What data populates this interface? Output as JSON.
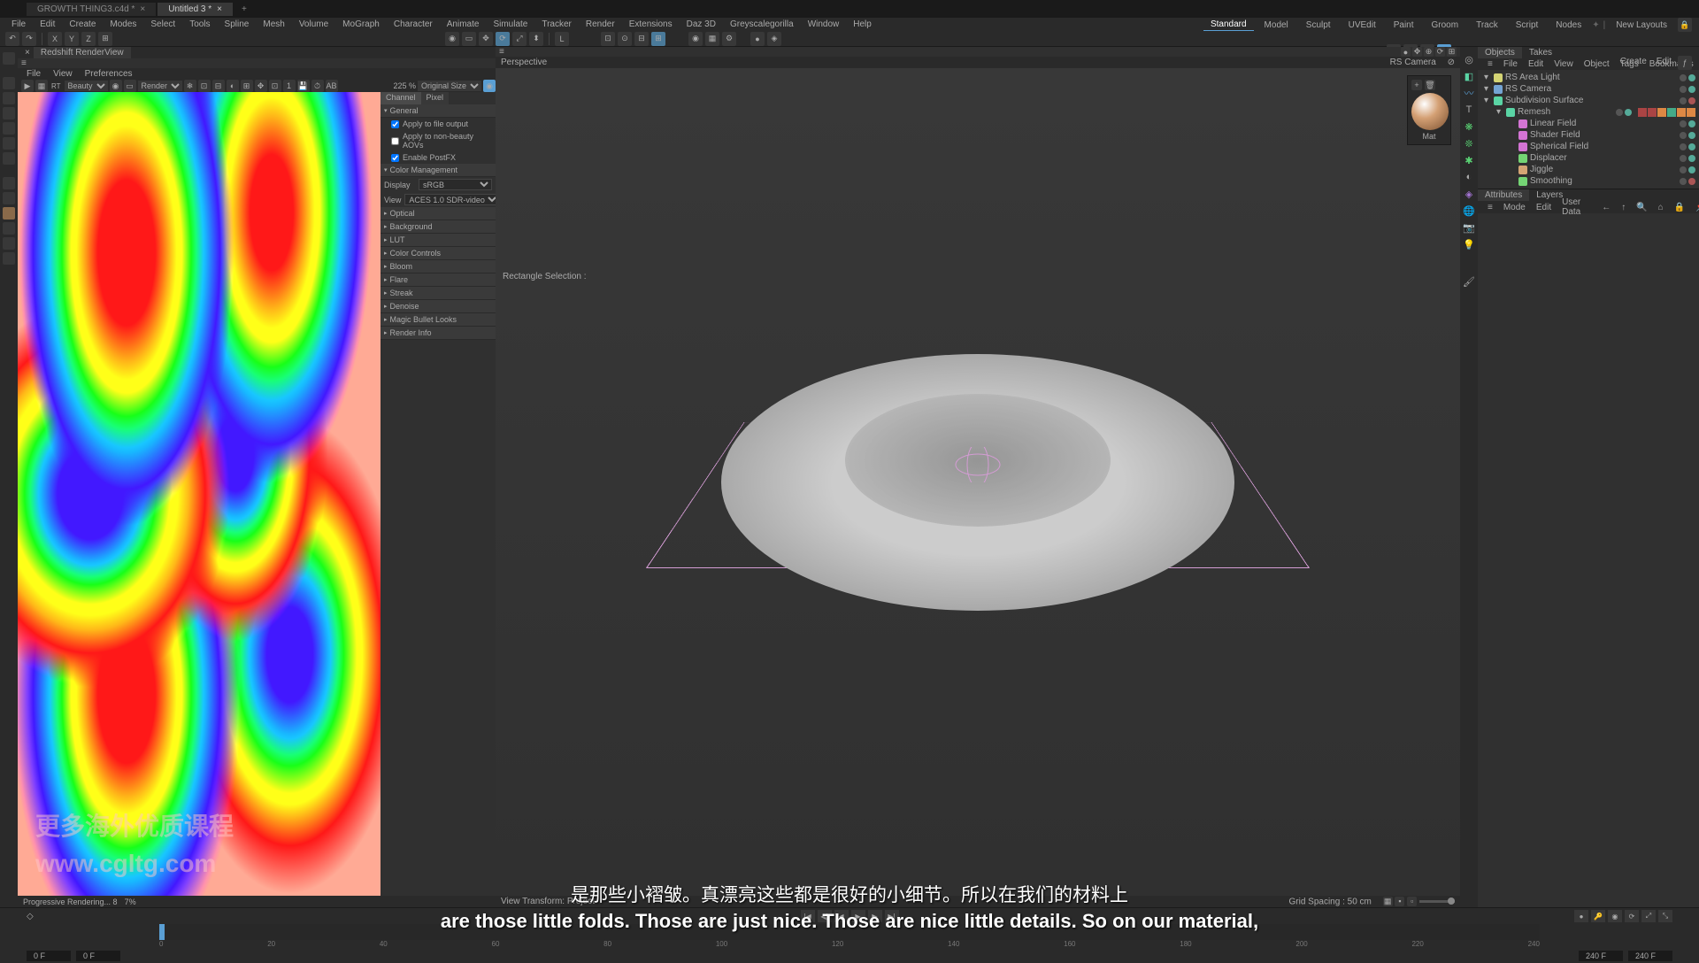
{
  "tabs": [
    {
      "label": "GROWTH THING3.c4d *",
      "active": false
    },
    {
      "label": "Untitled 3 *",
      "active": true
    }
  ],
  "menu": [
    "File",
    "Edit",
    "Create",
    "Modes",
    "Select",
    "Tools",
    "Spline",
    "Mesh",
    "Volume",
    "MoGraph",
    "Character",
    "Animate",
    "Simulate",
    "Tracker",
    "Render",
    "Extensions",
    "Daz 3D",
    "Greyscalegorilla",
    "Window",
    "Help"
  ],
  "workspaces": [
    "Standard",
    "Model",
    "Sculpt",
    "UVEdit",
    "Paint",
    "Groom",
    "Track",
    "Script",
    "Nodes"
  ],
  "new_layouts": "New Layouts",
  "render_tab": "Redshift RenderView",
  "render_menu": [
    "File",
    "View",
    "Preferences"
  ],
  "render_channel": "Beauty",
  "render_mode": "Render",
  "render_zoom": "225 %",
  "render_size": "Original Size",
  "settings_tabs": {
    "a": "Channel",
    "b": "Pixel"
  },
  "settings": {
    "general": "General",
    "apply_output": "Apply to file output",
    "apply_aovs": "Apply to non-beauty AOVs",
    "enable_postfx": "Enable PostFX",
    "color_mgmt": "Color Management",
    "display_label": "Display",
    "display_val": "sRGB",
    "view_label": "View",
    "view_val": "ACES 1.0 SDR-video",
    "optical": "Optical",
    "background": "Background",
    "lut": "LUT",
    "color_controls": "Color Controls",
    "bloom": "Bloom",
    "flare": "Flare",
    "streak": "Streak",
    "denoise": "Denoise",
    "magic": "Magic Bullet Looks",
    "render_info": "Render Info"
  },
  "watermark_cn": "更多海外优质课程",
  "watermark_url": "www.cgltg.com",
  "viewport": {
    "label": "Perspective",
    "camera": "RS Camera",
    "tool": "Rectangle Selection :",
    "view_transform": "View Transform: Project",
    "grid": "Grid Spacing : 50 cm"
  },
  "render_status": {
    "label": "Progressive Rendering... 8",
    "pct": "7%"
  },
  "material": "Mat",
  "obj_tabs": {
    "a": "Objects",
    "b": "Takes"
  },
  "obj_menu": [
    "File",
    "Edit",
    "View",
    "Object",
    "Tags",
    "Bookmarks"
  ],
  "obj_create": "Create",
  "obj_edit": "Edit",
  "tree": [
    {
      "indent": 0,
      "name": "RS Area Light",
      "icon": "#d4d474"
    },
    {
      "indent": 0,
      "name": "RS Camera",
      "icon": "#74a4d4"
    },
    {
      "indent": 0,
      "name": "Subdivision Surface",
      "icon": "#5ad4a4",
      "tags": true,
      "off": true
    },
    {
      "indent": 1,
      "name": "Remesh",
      "icon": "#5ad4a4",
      "extra_tags": true
    },
    {
      "indent": 2,
      "name": "Linear Field",
      "icon": "#d474d4"
    },
    {
      "indent": 2,
      "name": "Shader Field",
      "icon": "#d474d4"
    },
    {
      "indent": 2,
      "name": "Spherical Field",
      "icon": "#d474d4"
    },
    {
      "indent": 2,
      "name": "Displacer",
      "icon": "#74d474"
    },
    {
      "indent": 2,
      "name": "Jiggle",
      "icon": "#d4a474"
    },
    {
      "indent": 2,
      "name": "Smoothing",
      "icon": "#74d474",
      "off": true
    }
  ],
  "attr_tabs": {
    "a": "Attributes",
    "b": "Layers"
  },
  "attr_menu": [
    "Mode",
    "Edit",
    "User Data"
  ],
  "timeline": {
    "start": "0 F",
    "cur": "0 F",
    "end_a": "240 F",
    "end_b": "240 F",
    "marks": [
      "0",
      "20",
      "40",
      "60",
      "80",
      "100",
      "120",
      "140",
      "160",
      "180",
      "200",
      "220",
      "240"
    ]
  },
  "subtitle_cn": "是那些小褶皱。真漂亮这些都是很好的小细节。所以在我们的材料上",
  "subtitle_en": "are those little folds. Those are just nice. Those are nice little details. So on our material,"
}
